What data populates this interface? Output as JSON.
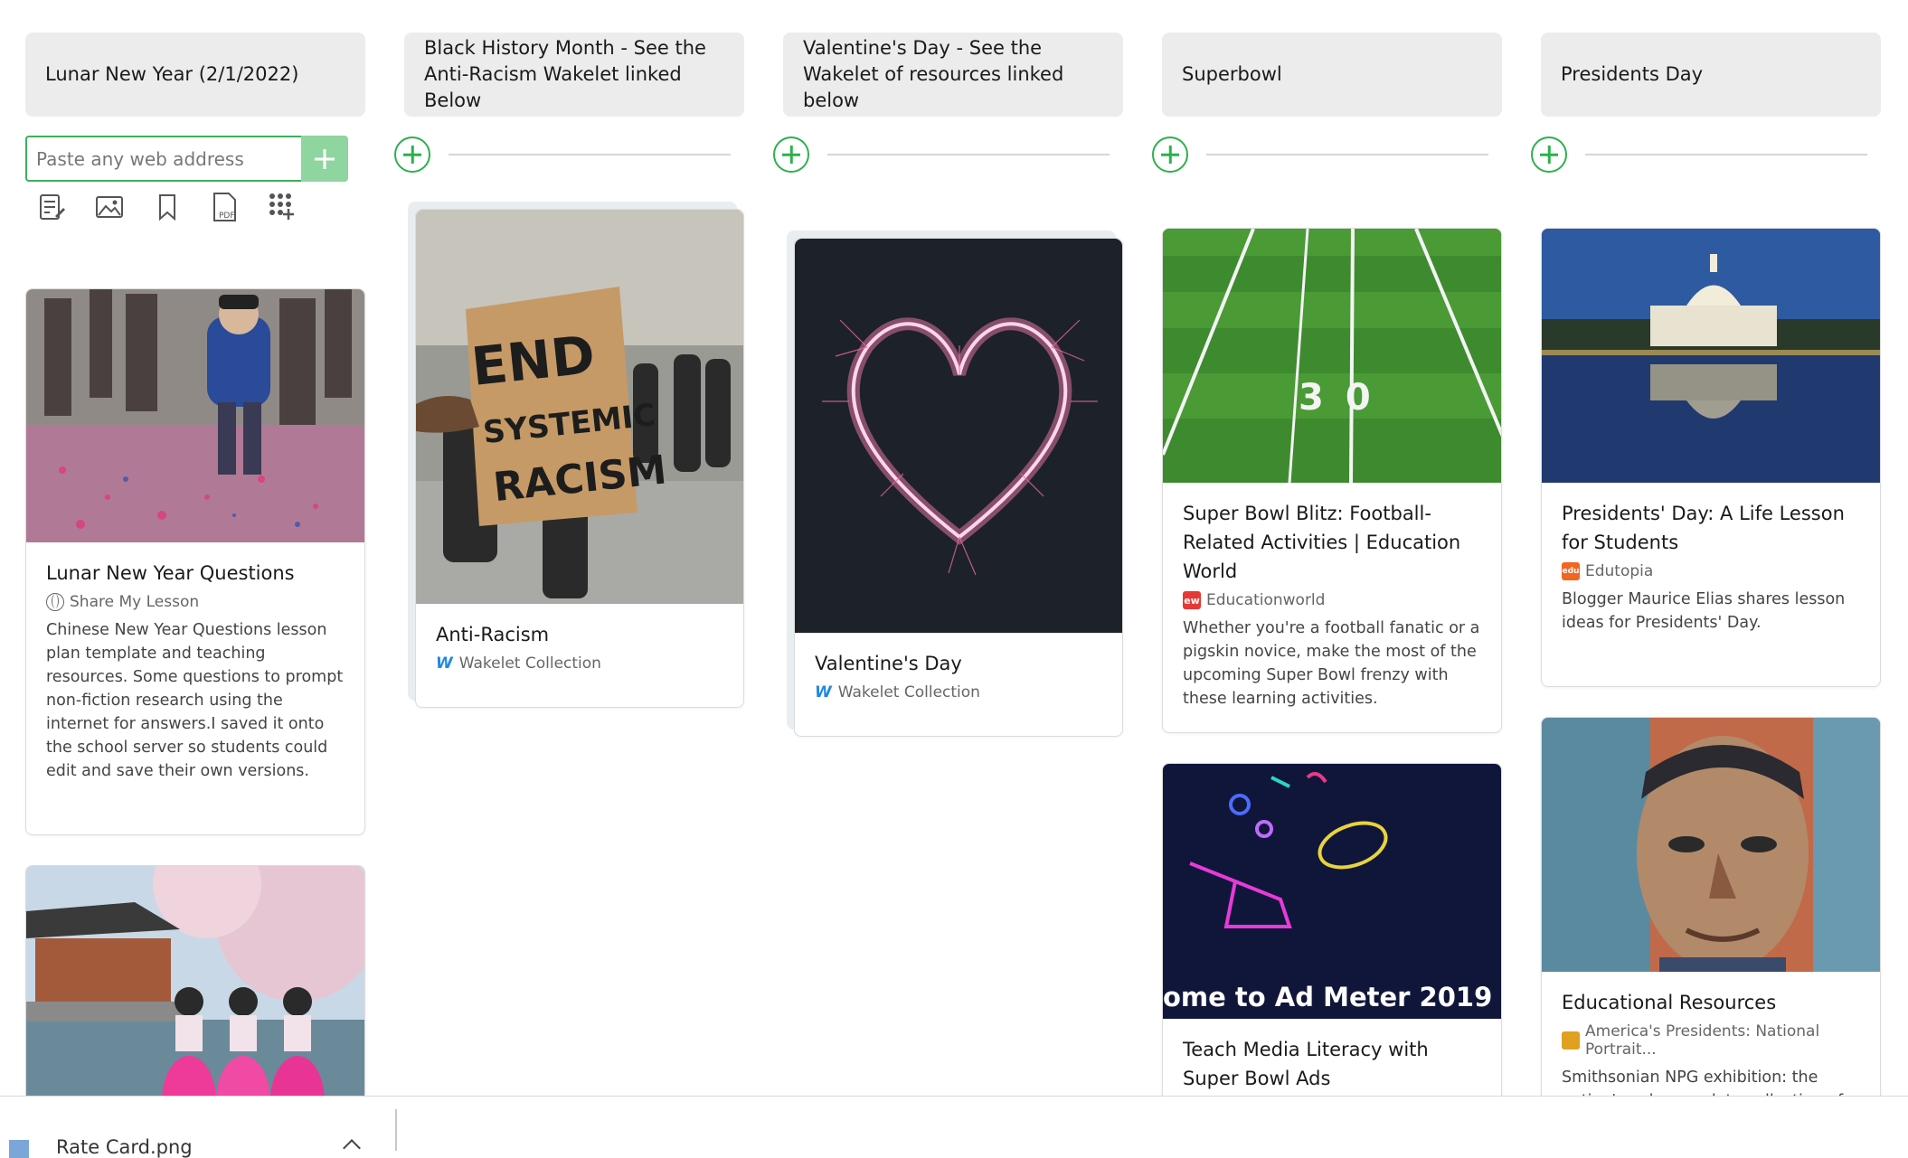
{
  "columns": [
    {
      "header": "Lunar New Year (2/1/2022)"
    },
    {
      "header": "Black History Month - See the Anti-Racism Wakelet linked Below"
    },
    {
      "header": "Valentine's Day - See the Wakelet of resources linked below"
    },
    {
      "header": "Superbowl"
    },
    {
      "header": "Presidents Day"
    }
  ],
  "url_input": {
    "placeholder": "Paste any web address"
  },
  "tools": [
    "text-note-icon",
    "image-icon",
    "bookmark-icon",
    "pdf-icon",
    "apps-grid-icon"
  ],
  "cards": {
    "lunar_questions": {
      "title": "Lunar New Year Questions",
      "source": "Share My Lesson",
      "desc": "Chinese New Year Questions lesson plan template and teaching resources. Some questions to prompt non-fiction research using the internet for answers.I saved it onto the school server so students could edit and save their own versions."
    },
    "anti_racism": {
      "title": "Anti-Racism",
      "source": "Wakelet Collection",
      "sign_text": [
        "END",
        "SYSTEMIC",
        "RACISM"
      ]
    },
    "valentines": {
      "title": "Valentine's Day",
      "source": "Wakelet Collection"
    },
    "superbowl_blitz": {
      "title": "Super Bowl Blitz: Football-Related Activities | Education World",
      "source": "Educationworld",
      "source_badge": "ew",
      "desc": "Whether you're a football fanatic or a pigskin novice, make the most of the upcoming Super Bowl frenzy with these learning activities.",
      "field_number": "30"
    },
    "media_literacy": {
      "title": "Teach Media Literacy with Super Bowl Ads",
      "image_text": "ome to Ad Meter 2019"
    },
    "presidents_lesson": {
      "title": "Presidents' Day: A Life Lesson for Students",
      "source": "Edutopia",
      "source_badge": "edu",
      "desc": "Blogger Maurice Elias shares lesson ideas for Presidents' Day."
    },
    "educational_resources": {
      "title": "Educational Resources",
      "source": "America's Presidents: National Portrait...",
      "desc": "Smithsonian NPG exhibition: the nation's only complete collection of"
    }
  },
  "bottom_bar": {
    "file_name": "Rate Card.png"
  },
  "colors": {
    "accent_green": "#2bb14c",
    "header_bg": "#ececec",
    "wakelet_blue": "#1e88e5",
    "ew_red": "#e53935",
    "edu_orange": "#f26522"
  }
}
